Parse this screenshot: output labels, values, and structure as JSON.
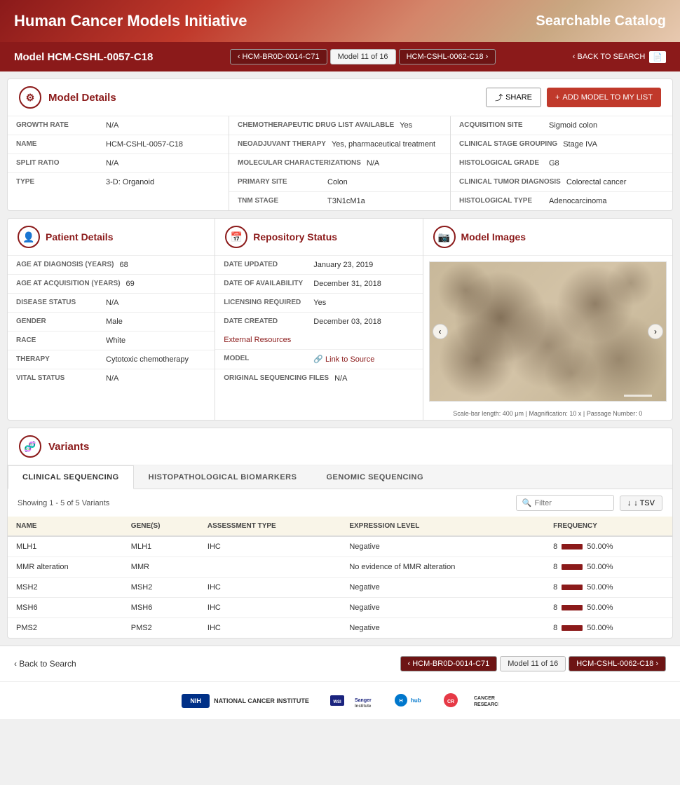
{
  "header": {
    "title": "Human Cancer Models Initiative",
    "subtitle": "Searchable Catalog"
  },
  "modelBar": {
    "modelId": "Model HCM-CSHL-0057-C18",
    "prevModel": "‹ HCM-BR0D-0014-C71",
    "modelCount": "Model 11 of 16",
    "nextModel": "HCM-CSHL-0062-C18 ›",
    "backToSearch": "‹ BACK TO SEARCH"
  },
  "modelDetails": {
    "sectionTitle": "Model Details",
    "shareLabel": "SHARE",
    "addToListLabel": "ADD MODEL TO MY LIST",
    "col1": [
      {
        "label": "GROWTH RATE",
        "value": "N/A"
      },
      {
        "label": "NAME",
        "value": "HCM-CSHL-0057-C18"
      },
      {
        "label": "SPLIT RATIO",
        "value": "N/A"
      },
      {
        "label": "TYPE",
        "value": "3-D: Organoid"
      }
    ],
    "col2": [
      {
        "label": "CHEMOTHERAPEUTIC DRUG LIST AVAILABLE",
        "value": "Yes"
      },
      {
        "label": "NEOADJUVANT THERAPY",
        "value": "Yes, pharmaceutical treatment"
      },
      {
        "label": "MOLECULAR CHARACTERIZATIONS",
        "value": "N/A"
      },
      {
        "label": "PRIMARY SITE",
        "value": "Colon"
      },
      {
        "label": "TNM STAGE",
        "value": "T3N1cM1a"
      }
    ],
    "col3": [
      {
        "label": "ACQUISITION SITE",
        "value": "Sigmoid colon"
      },
      {
        "label": "CLINICAL STAGE GROUPING",
        "value": "Stage IVA"
      },
      {
        "label": "HISTOLOGICAL GRADE",
        "value": "G8"
      },
      {
        "label": "CLINICAL TUMOR DIAGNOSIS",
        "value": "Colorectal cancer"
      },
      {
        "label": "HISTOLOGICAL TYPE",
        "value": "Adenocarcinoma"
      }
    ]
  },
  "patientDetails": {
    "sectionTitle": "Patient Details",
    "rows": [
      {
        "label": "AGE AT DIAGNOSIS (YEARS)",
        "value": "68"
      },
      {
        "label": "AGE AT ACQUISITION (YEARS)",
        "value": "69"
      },
      {
        "label": "DISEASE STATUS",
        "value": "N/A"
      },
      {
        "label": "GENDER",
        "value": "Male"
      },
      {
        "label": "RACE",
        "value": "White"
      },
      {
        "label": "THERAPY",
        "value": "Cytotoxic chemotherapy"
      },
      {
        "label": "VITAL STATUS",
        "value": "N/A"
      }
    ]
  },
  "repositoryStatus": {
    "sectionTitle": "Repository Status",
    "rows": [
      {
        "label": "DATE UPDATED",
        "value": "January 23, 2019"
      },
      {
        "label": "DATE OF AVAILABILITY",
        "value": "December 31, 2018"
      },
      {
        "label": "LICENSING REQUIRED",
        "value": "Yes"
      },
      {
        "label": "DATE CREATED",
        "value": "December 03, 2018"
      }
    ],
    "externalResourcesLabel": "External Resources",
    "modelLabel": "MODEL",
    "modelLinkText": "🔗 Link to Source",
    "originalSeqLabel": "ORIGINAL SEQUENCING FILES",
    "originalSeqValue": "N/A"
  },
  "modelImages": {
    "sectionTitle": "Model Images",
    "caption": "Scale-bar length: 400 μm  |  Magnification: 10 x  |  Passage Number: 0"
  },
  "variants": {
    "sectionTitle": "Variants",
    "tabs": [
      {
        "id": "clinical",
        "label": "CLINICAL SEQUENCING",
        "active": true
      },
      {
        "id": "histopathological",
        "label": "HISTOPATHOLOGICAL BIOMARKERS",
        "active": false
      },
      {
        "id": "genomic",
        "label": "GENOMIC SEQUENCING",
        "active": false
      }
    ],
    "showingText": "Showing 1 - 5 of 5 Variants",
    "filterPlaceholder": "Filter",
    "tsvLabel": "↓ TSV",
    "columns": [
      "NAME",
      "GENE(S)",
      "ASSESSMENT TYPE",
      "EXPRESSION LEVEL",
      "FREQUENCY"
    ],
    "rows": [
      {
        "name": "MLH1",
        "genes": "MLH1",
        "assessmentType": "IHC",
        "expressionLevel": "Negative",
        "freqNum": "8",
        "freqPct": "50.00%"
      },
      {
        "name": "MMR alteration",
        "genes": "MMR",
        "assessmentType": "",
        "expressionLevel": "No evidence of MMR alteration",
        "freqNum": "8",
        "freqPct": "50.00%"
      },
      {
        "name": "MSH2",
        "genes": "MSH2",
        "assessmentType": "IHC",
        "expressionLevel": "Negative",
        "freqNum": "8",
        "freqPct": "50.00%"
      },
      {
        "name": "MSH6",
        "genes": "MSH6",
        "assessmentType": "IHC",
        "expressionLevel": "Negative",
        "freqNum": "8",
        "freqPct": "50.00%"
      },
      {
        "name": "PMS2",
        "genes": "PMS2",
        "assessmentType": "IHC",
        "expressionLevel": "Negative",
        "freqNum": "8",
        "freqPct": "50.00%"
      }
    ]
  },
  "footerNav": {
    "backText": "‹ Back to Search",
    "prevModel": "‹ HCM-BR0D-0014-C71",
    "modelCount": "Model 11 of 16",
    "nextModel": "HCM-CSHL-0062-C18 ›"
  },
  "logos": [
    {
      "name": "National Cancer Institute",
      "abbr": "NIH"
    },
    {
      "name": "Wellcome Sanger Institute",
      "abbr": "Sanger"
    },
    {
      "name": "Hub",
      "abbr": "hub"
    },
    {
      "name": "Cancer Research UK",
      "abbr": "CRUK"
    }
  ],
  "icons": {
    "share": "⤴",
    "add": "+",
    "search": "🔍",
    "download": "↓",
    "prev": "‹",
    "next": "›",
    "link": "🔗",
    "modelDetails": "⚙",
    "patient": "👤",
    "repository": "📅",
    "images": "📷",
    "variants": "🧬"
  }
}
